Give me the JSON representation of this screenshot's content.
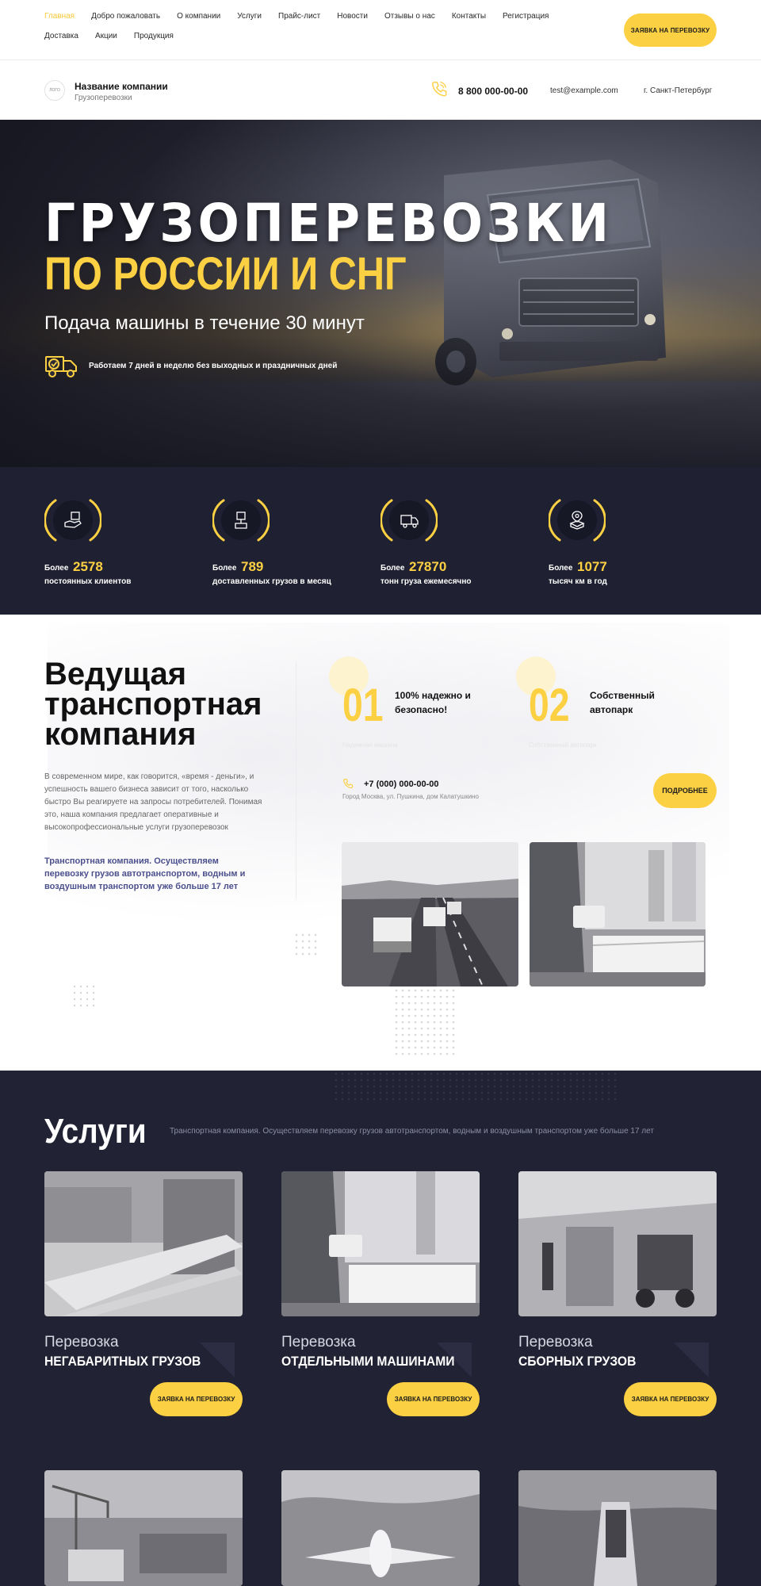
{
  "nav": {
    "items": [
      {
        "label": "Главная",
        "active": true
      },
      {
        "label": "Добро пожаловать"
      },
      {
        "label": "О компании"
      },
      {
        "label": "Услуги"
      },
      {
        "label": "Прайс-лист"
      },
      {
        "label": "Новости"
      },
      {
        "label": "Отзывы о нас"
      },
      {
        "label": "Контакты"
      },
      {
        "label": "Регистрация"
      },
      {
        "label": "Доставка"
      },
      {
        "label": "Акции"
      },
      {
        "label": "Продукция"
      }
    ],
    "cta": "Заявка на перевозку"
  },
  "header": {
    "logo_text": "ЛОГО",
    "company_name": "Название компании",
    "company_sub": "Грузоперевозки",
    "phone": "8 800 000-00-00",
    "email": "test@example.com",
    "city": "г. Санкт-Петербург"
  },
  "hero": {
    "title": "ГРУЗОПЕРЕВОЗКИ",
    "title_accent": "ПО РОССИИ И СНГ",
    "subtitle": "Подача машины в течение 30 минут",
    "note": "Работаем 7 дней в неделю без выходных и праздничных дней",
    "icon": "delivery-truck-icon"
  },
  "stats": [
    {
      "prefix": "Более",
      "value": "2578",
      "desc": "постоянных клиентов",
      "icon": "handshake-box-icon"
    },
    {
      "prefix": "Более",
      "value": "789",
      "desc": "доставленных грузов в месяц",
      "icon": "parcel-stand-icon"
    },
    {
      "prefix": "Более",
      "value": "27870",
      "desc": "тонн груза ежемесячно",
      "icon": "truck-box-icon"
    },
    {
      "prefix": "Более",
      "value": "1077",
      "desc": "тысяч км в год",
      "icon": "location-box-icon"
    }
  ],
  "about": {
    "title_lines": [
      "Ведущая",
      "транспортная",
      "компания"
    ],
    "text": "В современном мире, как говорится, «время - деньги», и успешность вашего бизнеса зависит от того, насколько быстро Вы реагируете на запросы потребителей. Понимая это, наша компания предлагает оперативные и высокопрофессиональные услуги грузоперевозок",
    "accent": "Транспортная компания. Осуществляем перевозку грузов автотранспортом, водным и воздушным транспортом уже больше 17 лет",
    "features": [
      {
        "num": "01",
        "text_lines": [
          "100% надежно и",
          "безопасно!"
        ],
        "faint": "Надежная машина"
      },
      {
        "num": "02",
        "text_lines": [
          "Собственный",
          "автопарк"
        ],
        "faint": "Собственный автопарк"
      }
    ],
    "phone": "+7 (000) 000-00-00",
    "address": "Город Москва, ул. Пушкина, дом Калатушкино",
    "more": "Подробнее"
  },
  "services": {
    "title": "Услуги",
    "subtitle": "Транспортная компания. Осуществляем перевозку грузов автотранспортом, водным и воздушным транспортом уже больше 17 лет",
    "items": [
      {
        "line1": "Перевозка",
        "line2": "НЕГАБАРИТНЫХ ГРУЗОВ",
        "button": "Заявка на перевозку"
      },
      {
        "line1": "Перевозка",
        "line2": "ОТДЕЛЬНЫМИ МАШИНАМИ",
        "button": "Заявка на перевозку"
      },
      {
        "line1": "Перевозка",
        "line2": "СБОРНЫХ ГРУЗОВ",
        "button": "Заявка на перевозку"
      }
    ]
  },
  "colors": {
    "accent": "#fcd043",
    "dark": "#212233",
    "stats_bg": "#1f2031",
    "link_accent": "#4b4f8c"
  }
}
